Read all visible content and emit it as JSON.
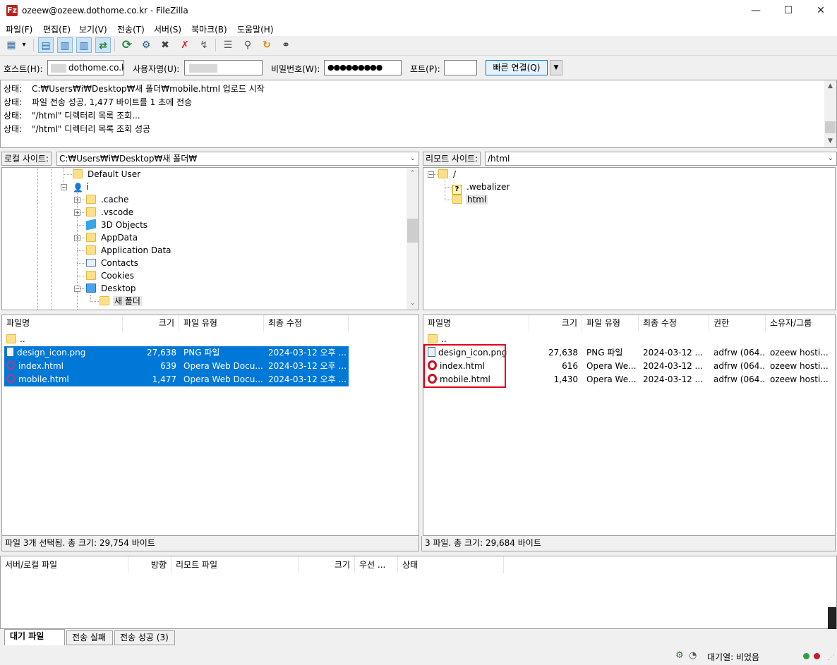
{
  "window": {
    "title": "ozeew@ozeew.dothome.co.kr - FileZilla",
    "app_icon": "Fz",
    "minimize": "—",
    "maximize": "☐",
    "close": "✕"
  },
  "menu": [
    "파일(F)",
    "편집(E)",
    "보기(V)",
    "전송(T)",
    "서버(S)",
    "북마크(B)",
    "도움말(H)"
  ],
  "toolbar": [
    {
      "icon": "site-manager-icon",
      "glyph": "▦"
    },
    {
      "icon": "dropdown-arrow-icon",
      "glyph": "▾"
    },
    {
      "icon": "toggle-log-icon",
      "glyph": "▤"
    },
    {
      "icon": "toggle-local-tree-icon",
      "glyph": "▥"
    },
    {
      "icon": "toggle-remote-tree-icon",
      "glyph": "▥"
    },
    {
      "icon": "toggle-queue-icon",
      "glyph": "⇄"
    },
    {
      "icon": "refresh-icon",
      "glyph": "⟳"
    },
    {
      "icon": "process-queue-icon",
      "glyph": "⚙"
    },
    {
      "icon": "cancel-icon",
      "glyph": "✖"
    },
    {
      "icon": "disconnect-icon",
      "glyph": "✗"
    },
    {
      "icon": "reconnect-icon",
      "glyph": "↯"
    },
    {
      "icon": "directory-filter-icon",
      "glyph": "☰"
    },
    {
      "icon": "search-icon",
      "glyph": "⚲"
    },
    {
      "icon": "sync-browse-icon",
      "glyph": "↻"
    },
    {
      "icon": "find-files-icon",
      "glyph": "⚭"
    }
  ],
  "quickconnect": {
    "host_label": "호스트(H):",
    "host_value": "dothome.co.kr",
    "user_label": "사용자명(U):",
    "pass_label": "비밀번호(W):",
    "pass_value": "●●●●●●●●●",
    "port_label": "포트(P):",
    "port_value": "",
    "connect_label": "빠른 연결(Q)",
    "dropdown": "▼"
  },
  "log": [
    {
      "key": "상태:",
      "msg": "C:₩Users₩i₩Desktop₩새 폴더₩mobile.html 업로드 시작"
    },
    {
      "key": "상태:",
      "msg": "파일 전송 성공, 1,477 바이트를 1 초에 전송"
    },
    {
      "key": "상태:",
      "msg": "\"/html\" 디렉터리 목록 조회..."
    },
    {
      "key": "상태:",
      "msg": "\"/html\" 디렉터리 목록 조회 성공"
    }
  ],
  "local": {
    "site_label": "로컬 사이트:",
    "path": "C:₩Users₩i₩Desktop₩새 폴더₩",
    "tree": [
      "Default User",
      "i",
      ".cache",
      ".vscode",
      "3D Objects",
      "AppData",
      "Application Data",
      "Contacts",
      "Cookies",
      "Desktop",
      "새 폴더"
    ],
    "columns": [
      "파일명",
      "크기",
      "파일 유형",
      "최종 수정"
    ],
    "parent": "..",
    "files": [
      {
        "name": "design_icon.png",
        "size": "27,638",
        "type": "PNG 파일",
        "modified": "2024-03-12 오후 ..."
      },
      {
        "name": "index.html",
        "size": "639",
        "type": "Opera Web Docu...",
        "modified": "2024-03-12 오후 ..."
      },
      {
        "name": "mobile.html",
        "size": "1,477",
        "type": "Opera Web Docu...",
        "modified": "2024-03-12 오후 ..."
      }
    ],
    "status": "파일 3개 선택됨. 총 크기: 29,754 바이트"
  },
  "remote": {
    "site_label": "리모트 사이트:",
    "path": "/html",
    "tree": [
      "/",
      ".webalizer",
      "html"
    ],
    "columns": [
      "파일명",
      "크기",
      "파일 유형",
      "최종 수정",
      "권한",
      "소유자/그룹"
    ],
    "parent": "..",
    "files": [
      {
        "name": "design_icon.png",
        "size": "27,638",
        "type": "PNG 파일",
        "modified": "2024-03-12 ...",
        "perm": "adfrw (064...",
        "owner": "ozeew hosti..."
      },
      {
        "name": "index.html",
        "size": "616",
        "type": "Opera We...",
        "modified": "2024-03-12 ...",
        "perm": "adfrw (064...",
        "owner": "ozeew hosti..."
      },
      {
        "name": "mobile.html",
        "size": "1,430",
        "type": "Opera We...",
        "modified": "2024-03-12 ...",
        "perm": "adfrw (064...",
        "owner": "ozeew hosti..."
      }
    ],
    "status": "3 파일. 총 크기: 29,684 바이트"
  },
  "queue": {
    "columns": [
      "서버/로컬 파일",
      "방향",
      "리모트 파일",
      "크기",
      "우선 ...",
      "상태"
    ],
    "tabs": [
      "대기 파일",
      "전송 실패",
      "전송 성공 (3)"
    ]
  },
  "statusbar": {
    "queue_text": "대기열: 비었음"
  },
  "colors": {
    "selection": "#0078d7",
    "highlight_box": "#e0001a",
    "led_green": "#2ea043",
    "led_red": "#c0202a"
  }
}
